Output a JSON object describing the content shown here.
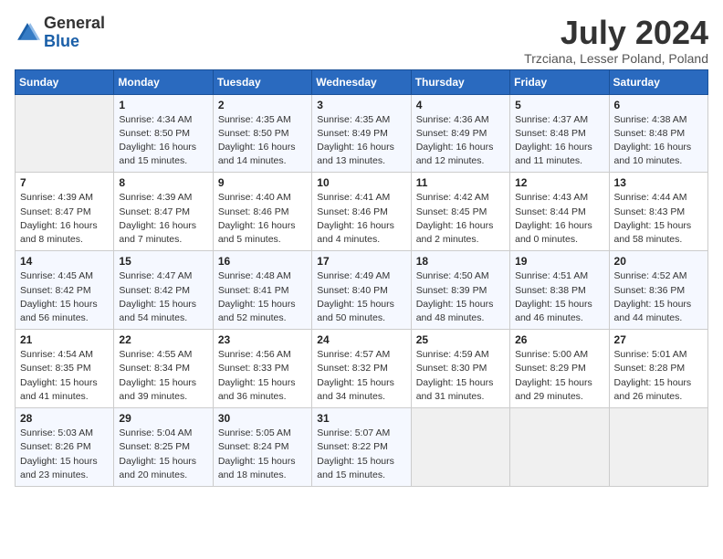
{
  "header": {
    "logo_general": "General",
    "logo_blue": "Blue",
    "month_title": "July 2024",
    "subtitle": "Trzciana, Lesser Poland, Poland"
  },
  "calendar": {
    "days_of_week": [
      "Sunday",
      "Monday",
      "Tuesday",
      "Wednesday",
      "Thursday",
      "Friday",
      "Saturday"
    ],
    "weeks": [
      [
        {
          "day": "",
          "info": ""
        },
        {
          "day": "1",
          "info": "Sunrise: 4:34 AM\nSunset: 8:50 PM\nDaylight: 16 hours\nand 15 minutes."
        },
        {
          "day": "2",
          "info": "Sunrise: 4:35 AM\nSunset: 8:50 PM\nDaylight: 16 hours\nand 14 minutes."
        },
        {
          "day": "3",
          "info": "Sunrise: 4:35 AM\nSunset: 8:49 PM\nDaylight: 16 hours\nand 13 minutes."
        },
        {
          "day": "4",
          "info": "Sunrise: 4:36 AM\nSunset: 8:49 PM\nDaylight: 16 hours\nand 12 minutes."
        },
        {
          "day": "5",
          "info": "Sunrise: 4:37 AM\nSunset: 8:48 PM\nDaylight: 16 hours\nand 11 minutes."
        },
        {
          "day": "6",
          "info": "Sunrise: 4:38 AM\nSunset: 8:48 PM\nDaylight: 16 hours\nand 10 minutes."
        }
      ],
      [
        {
          "day": "7",
          "info": "Sunrise: 4:39 AM\nSunset: 8:47 PM\nDaylight: 16 hours\nand 8 minutes."
        },
        {
          "day": "8",
          "info": "Sunrise: 4:39 AM\nSunset: 8:47 PM\nDaylight: 16 hours\nand 7 minutes."
        },
        {
          "day": "9",
          "info": "Sunrise: 4:40 AM\nSunset: 8:46 PM\nDaylight: 16 hours\nand 5 minutes."
        },
        {
          "day": "10",
          "info": "Sunrise: 4:41 AM\nSunset: 8:46 PM\nDaylight: 16 hours\nand 4 minutes."
        },
        {
          "day": "11",
          "info": "Sunrise: 4:42 AM\nSunset: 8:45 PM\nDaylight: 16 hours\nand 2 minutes."
        },
        {
          "day": "12",
          "info": "Sunrise: 4:43 AM\nSunset: 8:44 PM\nDaylight: 16 hours\nand 0 minutes."
        },
        {
          "day": "13",
          "info": "Sunrise: 4:44 AM\nSunset: 8:43 PM\nDaylight: 15 hours\nand 58 minutes."
        }
      ],
      [
        {
          "day": "14",
          "info": "Sunrise: 4:45 AM\nSunset: 8:42 PM\nDaylight: 15 hours\nand 56 minutes."
        },
        {
          "day": "15",
          "info": "Sunrise: 4:47 AM\nSunset: 8:42 PM\nDaylight: 15 hours\nand 54 minutes."
        },
        {
          "day": "16",
          "info": "Sunrise: 4:48 AM\nSunset: 8:41 PM\nDaylight: 15 hours\nand 52 minutes."
        },
        {
          "day": "17",
          "info": "Sunrise: 4:49 AM\nSunset: 8:40 PM\nDaylight: 15 hours\nand 50 minutes."
        },
        {
          "day": "18",
          "info": "Sunrise: 4:50 AM\nSunset: 8:39 PM\nDaylight: 15 hours\nand 48 minutes."
        },
        {
          "day": "19",
          "info": "Sunrise: 4:51 AM\nSunset: 8:38 PM\nDaylight: 15 hours\nand 46 minutes."
        },
        {
          "day": "20",
          "info": "Sunrise: 4:52 AM\nSunset: 8:36 PM\nDaylight: 15 hours\nand 44 minutes."
        }
      ],
      [
        {
          "day": "21",
          "info": "Sunrise: 4:54 AM\nSunset: 8:35 PM\nDaylight: 15 hours\nand 41 minutes."
        },
        {
          "day": "22",
          "info": "Sunrise: 4:55 AM\nSunset: 8:34 PM\nDaylight: 15 hours\nand 39 minutes."
        },
        {
          "day": "23",
          "info": "Sunrise: 4:56 AM\nSunset: 8:33 PM\nDaylight: 15 hours\nand 36 minutes."
        },
        {
          "day": "24",
          "info": "Sunrise: 4:57 AM\nSunset: 8:32 PM\nDaylight: 15 hours\nand 34 minutes."
        },
        {
          "day": "25",
          "info": "Sunrise: 4:59 AM\nSunset: 8:30 PM\nDaylight: 15 hours\nand 31 minutes."
        },
        {
          "day": "26",
          "info": "Sunrise: 5:00 AM\nSunset: 8:29 PM\nDaylight: 15 hours\nand 29 minutes."
        },
        {
          "day": "27",
          "info": "Sunrise: 5:01 AM\nSunset: 8:28 PM\nDaylight: 15 hours\nand 26 minutes."
        }
      ],
      [
        {
          "day": "28",
          "info": "Sunrise: 5:03 AM\nSunset: 8:26 PM\nDaylight: 15 hours\nand 23 minutes."
        },
        {
          "day": "29",
          "info": "Sunrise: 5:04 AM\nSunset: 8:25 PM\nDaylight: 15 hours\nand 20 minutes."
        },
        {
          "day": "30",
          "info": "Sunrise: 5:05 AM\nSunset: 8:24 PM\nDaylight: 15 hours\nand 18 minutes."
        },
        {
          "day": "31",
          "info": "Sunrise: 5:07 AM\nSunset: 8:22 PM\nDaylight: 15 hours\nand 15 minutes."
        },
        {
          "day": "",
          "info": ""
        },
        {
          "day": "",
          "info": ""
        },
        {
          "day": "",
          "info": ""
        }
      ]
    ]
  }
}
